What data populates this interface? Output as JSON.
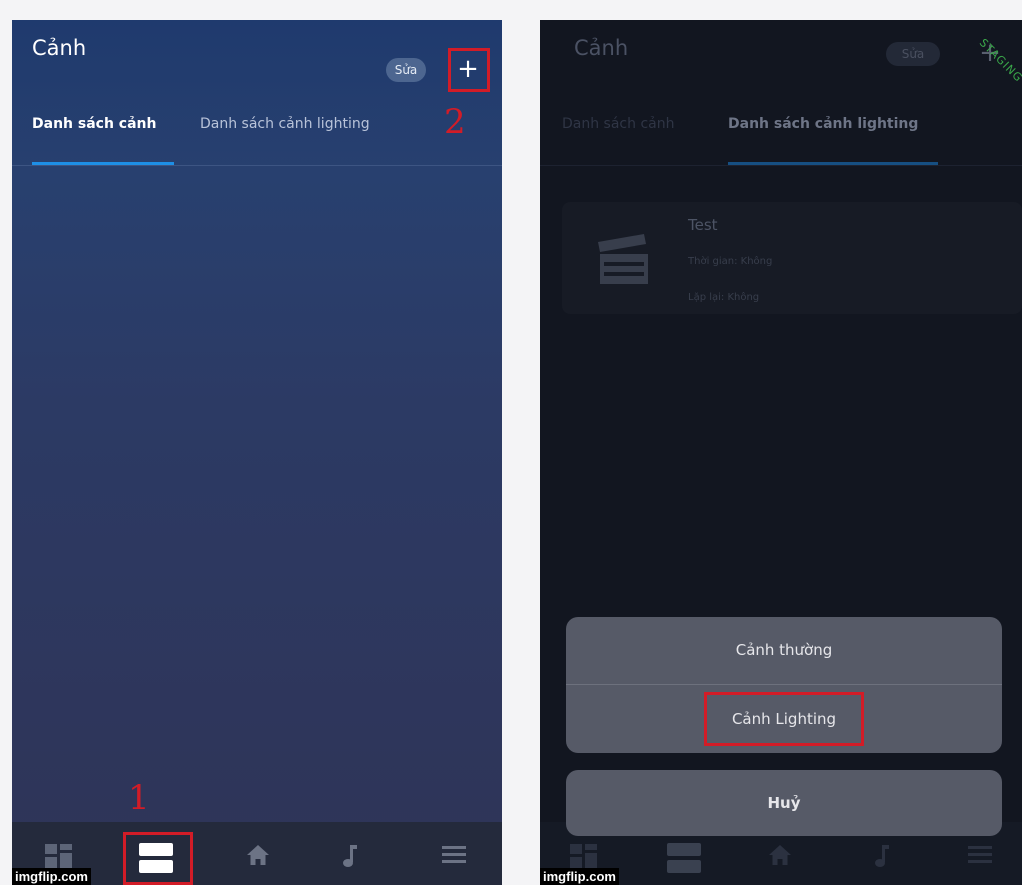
{
  "left": {
    "title": "Cảnh",
    "edit_label": "Sửa",
    "add_label": "+",
    "tabs": [
      "Danh sách cảnh",
      "Danh sách cảnh lighting"
    ],
    "annotations": [
      "1",
      "2"
    ],
    "watermark": "imgflip.com"
  },
  "right": {
    "title": "Cảnh",
    "edit_label": "Sửa",
    "add_label": "+",
    "ribbon": "STAGING",
    "tabs": [
      "Danh sách cảnh",
      "Danh sách cảnh lighting"
    ],
    "scene": {
      "name": "Test",
      "time": "Thời gian: Không",
      "repeat": "Lặp lại: Không"
    },
    "sheet_options": [
      "Cảnh thường",
      "Cảnh Lighting"
    ],
    "cancel_label": "Huỷ",
    "watermark": "imgflip.com"
  },
  "colors": {
    "accent": "#1e8fe6",
    "highlight": "#d21c27"
  }
}
